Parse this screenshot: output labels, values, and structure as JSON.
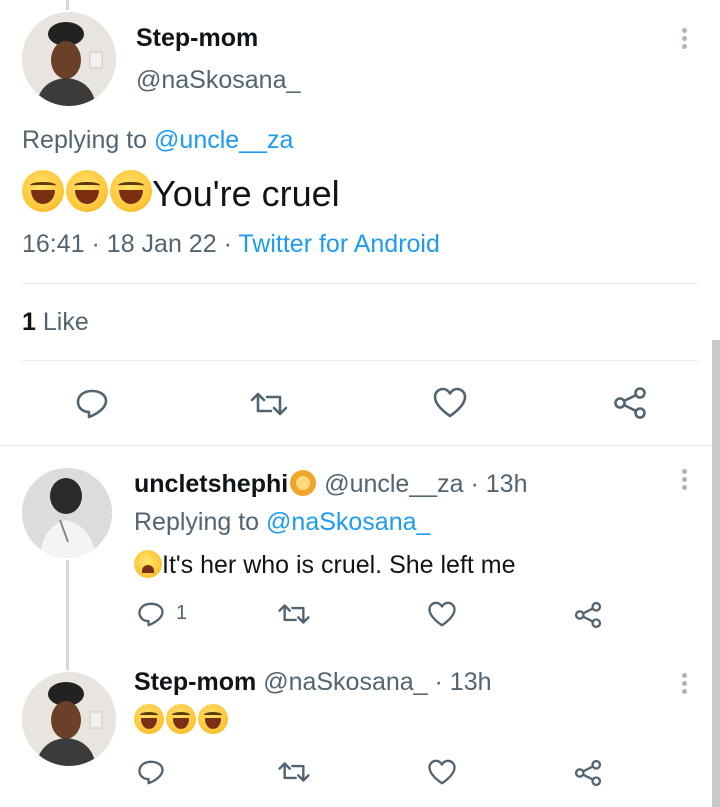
{
  "main_tweet": {
    "display_name": "Step-mom",
    "handle": "@naSkosana_",
    "replying_label": "Replying to",
    "replying_handle": "@uncle__za",
    "text": "You're cruel",
    "time": "16:41",
    "date": "18 Jan 22",
    "source": "Twitter for Android",
    "likes_count": "1",
    "likes_label": "Like"
  },
  "reply_1": {
    "display_name": "uncletshephi",
    "handle": "@uncle__za",
    "age": "· 13h",
    "replying_label": "Replying to",
    "replying_handle": "@naSkosana_",
    "text": "It's her who is cruel. She left me",
    "reply_count": "1"
  },
  "reply_2": {
    "display_name": "Step-mom",
    "handle": "@naSkosana_",
    "age": "· 13h"
  },
  "sep": "·",
  "colors": {
    "link": "#1d9bf0",
    "muted": "#536471",
    "divider": "#e6ecf0",
    "icon": "#536471"
  },
  "icons": [
    "reply-icon",
    "retweet-icon",
    "like-icon",
    "share-icon",
    "more-icon"
  ]
}
